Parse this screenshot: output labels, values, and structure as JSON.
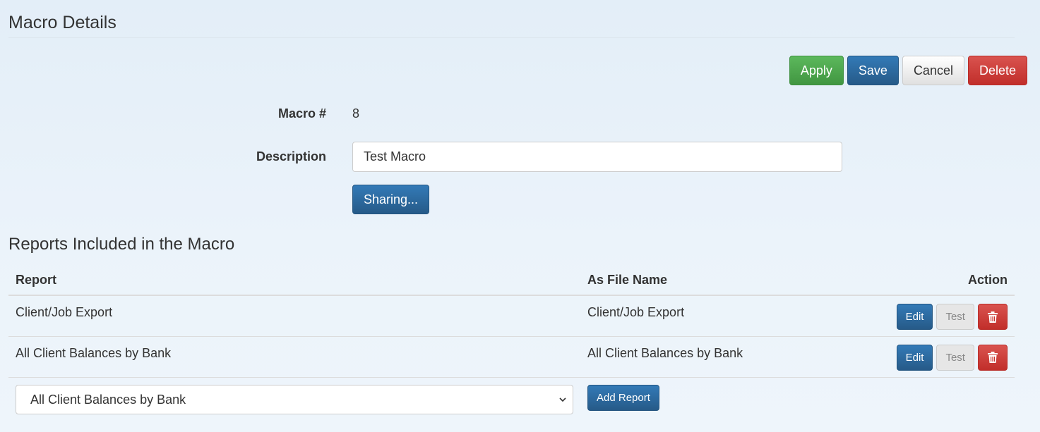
{
  "page": {
    "title": "Macro Details"
  },
  "toolbar": {
    "apply": "Apply",
    "save": "Save",
    "cancel": "Cancel",
    "delete": "Delete"
  },
  "form": {
    "macro_label": "Macro #",
    "macro_value": "8",
    "description_label": "Description",
    "description_value": "Test Macro",
    "sharing_label": "Sharing..."
  },
  "reports": {
    "title": "Reports Included in the Macro",
    "headers": {
      "report": "Report",
      "file_name": "As File Name",
      "action": "Action"
    },
    "rows": [
      {
        "report": "Client/Job Export",
        "file_name": "Client/Job Export",
        "edit": "Edit",
        "test": "Test"
      },
      {
        "report": "All Client Balances by Bank",
        "file_name": "All Client Balances by Bank",
        "edit": "Edit",
        "test": "Test"
      }
    ],
    "selected_report": "All Client Balances by Bank",
    "add_label": "Add Report"
  },
  "icons": {
    "delete": "trash-icon",
    "dropdown": "chevron-down-icon"
  },
  "colors": {
    "success": "#5cb85c",
    "primary": "#337ab7",
    "danger": "#d9534f"
  }
}
